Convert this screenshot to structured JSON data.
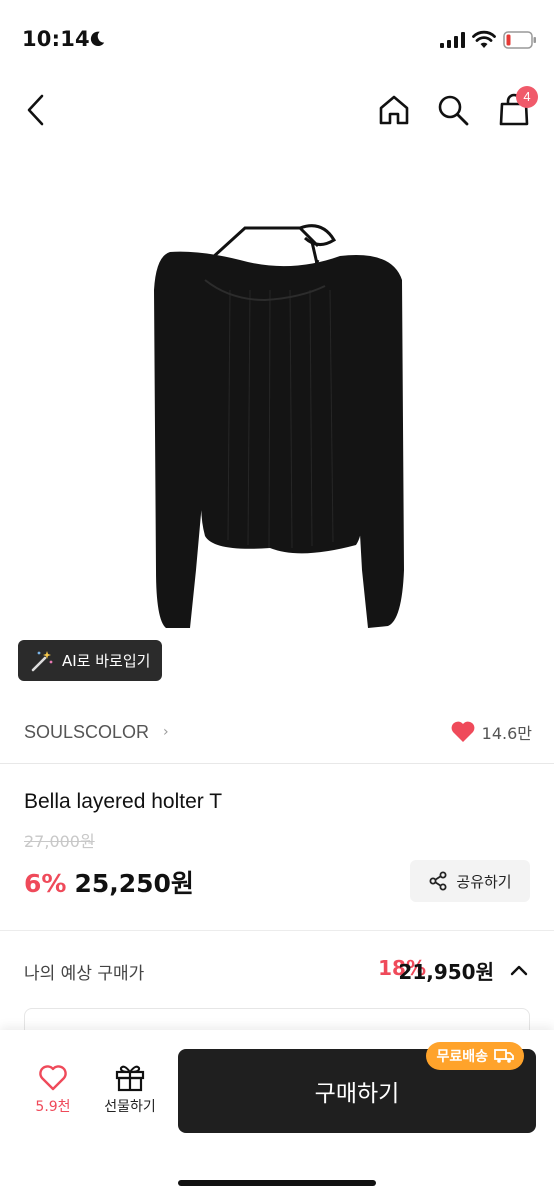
{
  "status_bar": {
    "time": "10:14"
  },
  "nav": {
    "cart_count": "4"
  },
  "product": {
    "ai_tryon_label": "AI로 바로입기",
    "brand": "SOULSCOLOR",
    "likes": "14.6만",
    "title": "Bella layered holter T",
    "original_price": "27,000원",
    "discount": "6%",
    "price": "25,250원",
    "share_label": "공유하기"
  },
  "expected": {
    "label": "나의 예상 구매가",
    "discount": "18%",
    "price": "21,950원"
  },
  "bottom_bar": {
    "wish_count": "5.9천",
    "gift_label": "선물하기",
    "buy_label": "구매하기",
    "free_shipping": "무료배송"
  },
  "colors": {
    "accent": "#ef4a5a",
    "buy_button": "#1f1f1f",
    "free_shipping": "#ffa32b"
  },
  "icons": [
    "moon-icon",
    "signal-icon",
    "wifi-icon",
    "battery-icon",
    "back-icon",
    "home-icon",
    "search-icon",
    "cart-icon",
    "magic-wand-icon",
    "heart-icon",
    "share-icon",
    "chevron-up-icon",
    "gift-icon",
    "truck-icon"
  ]
}
